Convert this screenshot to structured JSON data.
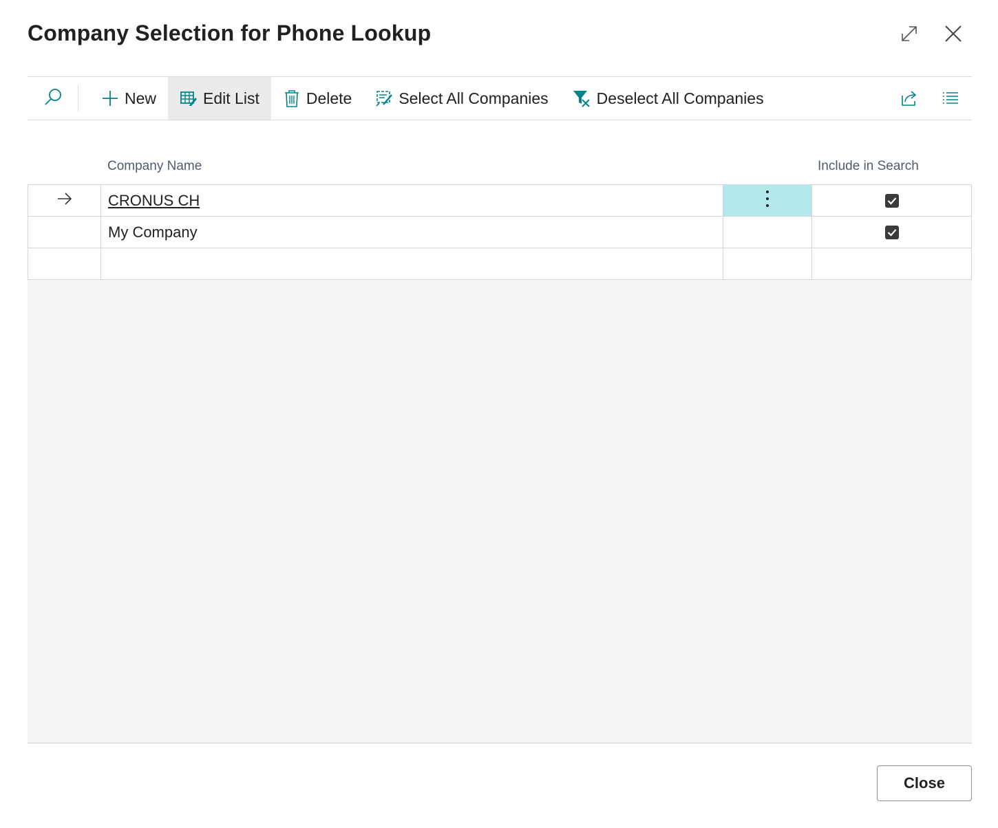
{
  "dialog": {
    "title": "Company Selection for Phone Lookup"
  },
  "title_icons": [
    "expand-icon",
    "close-icon"
  ],
  "toolbar": {
    "search_icon": "search-icon",
    "new_label": "New",
    "edit_list_label": "Edit List",
    "delete_label": "Delete",
    "select_all_label": "Select All Companies",
    "deselect_all_label": "Deselect All Companies",
    "right_icons": [
      "share-icon",
      "list-view-icon"
    ]
  },
  "grid": {
    "columns": {
      "company_name": "Company Name",
      "include_in_search": "Include in Search"
    },
    "rows": [
      {
        "company_name": "CRONUS CH",
        "include_in_search": true,
        "selected": true
      },
      {
        "company_name": "My Company",
        "include_in_search": true,
        "selected": false
      }
    ]
  },
  "footer": {
    "close_label": "Close"
  },
  "colors": {
    "accent": "#008489",
    "selected_cell": "#b3e8ec",
    "empty_area": "#f4f5f7"
  }
}
